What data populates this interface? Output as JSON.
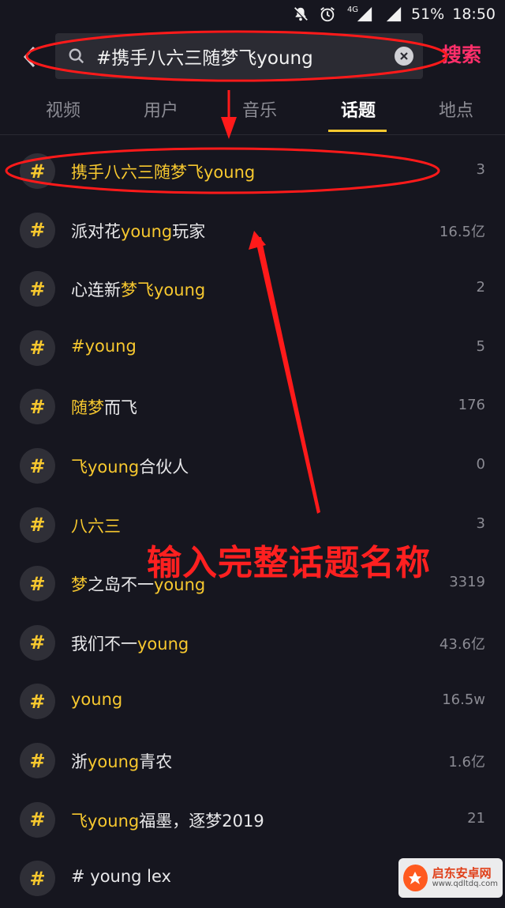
{
  "status_bar": {
    "network": "4G",
    "battery": "51%",
    "time": "18:50"
  },
  "search": {
    "query": "#携手八六三随梦飞young",
    "button_label": "搜索"
  },
  "tabs": [
    {
      "label": "视频",
      "active": false
    },
    {
      "label": "用户",
      "active": false
    },
    {
      "label": "音乐",
      "active": false
    },
    {
      "label": "话题",
      "active": true
    },
    {
      "label": "地点",
      "active": false
    }
  ],
  "topics": [
    {
      "parts": [
        [
          "携手八六三随梦飞young",
          true
        ]
      ],
      "count": "3"
    },
    {
      "parts": [
        [
          "派对花",
          false
        ],
        [
          "young",
          true
        ],
        [
          "玩家",
          false
        ]
      ],
      "count": "16.5亿"
    },
    {
      "parts": [
        [
          "心连新",
          false
        ],
        [
          "梦飞young",
          true
        ]
      ],
      "count": "2"
    },
    {
      "parts": [
        [
          "#young",
          true
        ]
      ],
      "count": "5"
    },
    {
      "parts": [
        [
          "随梦",
          true
        ],
        [
          "而飞",
          false
        ]
      ],
      "count": "176"
    },
    {
      "parts": [
        [
          "飞young",
          true
        ],
        [
          "合伙人",
          false
        ]
      ],
      "count": "0"
    },
    {
      "parts": [
        [
          "八六三",
          true
        ]
      ],
      "count": "3"
    },
    {
      "parts": [
        [
          "梦",
          true
        ],
        [
          "之岛不一",
          false
        ],
        [
          "young",
          true
        ]
      ],
      "count": "3319"
    },
    {
      "parts": [
        [
          "我们不一",
          false
        ],
        [
          "young",
          true
        ]
      ],
      "count": "43.6亿"
    },
    {
      "parts": [
        [
          "young",
          true
        ]
      ],
      "count": "16.5w"
    },
    {
      "parts": [
        [
          "浙",
          false
        ],
        [
          "young",
          true
        ],
        [
          "青农",
          false
        ]
      ],
      "count": "1.6亿"
    },
    {
      "parts": [
        [
          "飞young",
          true
        ],
        [
          "福墨，逐梦2019",
          false
        ]
      ],
      "count": "21"
    },
    {
      "parts": [
        [
          "# young lex",
          false
        ]
      ],
      "count": ""
    }
  ],
  "annotation": {
    "text": "输入完整话题名称"
  },
  "watermark": {
    "title": "启东安卓网",
    "url": "www.qdltdq.com"
  },
  "colors": {
    "background": "#16161f",
    "accent_yellow": "#f7c82f",
    "search_pink": "#ff2f6a",
    "annotation_red": "#ff2020"
  }
}
